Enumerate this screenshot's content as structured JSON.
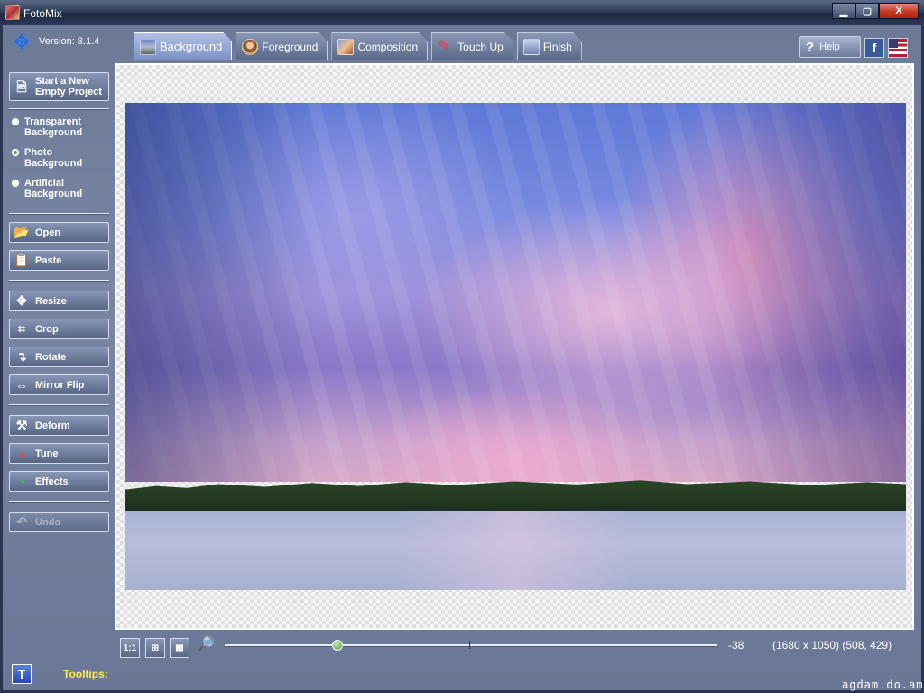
{
  "window": {
    "title": "FotoMix",
    "controls": {
      "minimize": "▁",
      "maximize": "▢",
      "close": "X"
    }
  },
  "version": "Version: 8.1.4",
  "tabs": [
    {
      "label": "Background",
      "active": true
    },
    {
      "label": "Foreground",
      "active": false
    },
    {
      "label": "Composition",
      "active": false
    },
    {
      "label": "Touch Up",
      "active": false
    },
    {
      "label": "Finish",
      "active": false
    }
  ],
  "header": {
    "help_label": "Help",
    "facebook": "f"
  },
  "sidebar": {
    "new_project": [
      "Start a New",
      "Empty Project"
    ],
    "background_options": [
      {
        "label": [
          "Transparent",
          "Background"
        ],
        "checked": false
      },
      {
        "label": [
          "Photo",
          "Background"
        ],
        "checked": true
      },
      {
        "label": [
          "Artificial",
          "Background"
        ],
        "checked": false
      }
    ],
    "open": "Open",
    "paste": "Paste",
    "resize": "Resize",
    "crop": "Crop",
    "rotate": "Rotate",
    "mirror_flip": "Mirror Flip",
    "deform": "Deform",
    "tune": "Tune",
    "effects": "Effects",
    "undo": "Undo"
  },
  "bottom": {
    "actual_size": "1:1",
    "zoom_value": "-38",
    "image_info": "(1680 x 1050) (508, 429)",
    "tooltips_label": "Tooltips:",
    "tooltip_toggle": "T"
  },
  "watermark": "agdam.do.am"
}
